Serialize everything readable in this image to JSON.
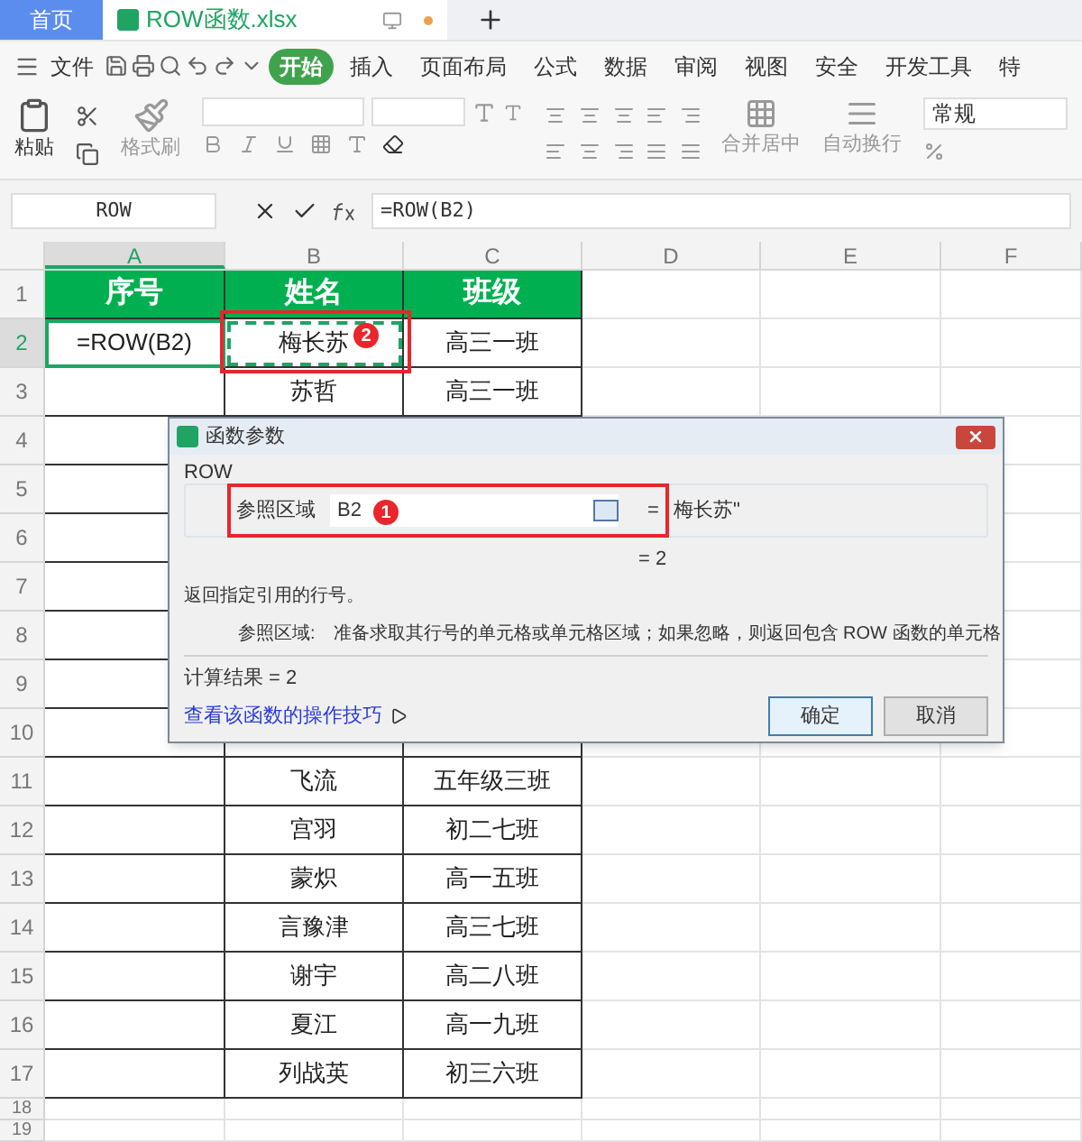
{
  "tabs": [
    {
      "label": "首页",
      "kind": "home",
      "selected": false
    },
    {
      "label": "ROW函数.xlsx",
      "kind": "file",
      "selected": true,
      "modified": true
    }
  ],
  "menu": {
    "file": "文件",
    "tabs": [
      {
        "label": "开始",
        "selected": true
      },
      {
        "label": "插入",
        "selected": false
      },
      {
        "label": "页面布局",
        "selected": false
      },
      {
        "label": "公式",
        "selected": false
      },
      {
        "label": "数据",
        "selected": false
      },
      {
        "label": "审阅",
        "selected": false
      },
      {
        "label": "视图",
        "selected": false
      },
      {
        "label": "安全",
        "selected": false
      },
      {
        "label": "开发工具",
        "selected": false
      },
      {
        "label": "特",
        "selected": false
      }
    ]
  },
  "ribbon": {
    "paste": "粘贴",
    "format_painter": "格式刷",
    "merge": "合并居中",
    "wrap": "自动换行",
    "number_format": "常规"
  },
  "formula_bar": {
    "name_box": "ROW",
    "formula": "=ROW(B2)"
  },
  "columns": [
    {
      "label": "A",
      "selected": true
    },
    {
      "label": "B",
      "selected": false
    },
    {
      "label": "C",
      "selected": false
    },
    {
      "label": "D",
      "selected": false
    },
    {
      "label": "E",
      "selected": false
    },
    {
      "label": "F",
      "selected": false
    }
  ],
  "rows": [
    {
      "header": "1",
      "kind": "heading",
      "selected": false,
      "referenced": false,
      "a": "序号",
      "b": "姓名",
      "c": "班级"
    },
    {
      "header": "2",
      "kind": "data",
      "selected": true,
      "referenced": true,
      "a": "=ROW(B2)",
      "b": "梅长苏",
      "c": "高三一班"
    },
    {
      "header": "3",
      "kind": "data",
      "selected": false,
      "referenced": false,
      "b": "苏哲",
      "c": "高三一班"
    },
    {
      "header": "4",
      "kind": "data",
      "selected": false
    },
    {
      "header": "5",
      "kind": "data",
      "selected": false
    },
    {
      "header": "6",
      "kind": "data",
      "selected": false
    },
    {
      "header": "7",
      "kind": "data",
      "selected": false
    },
    {
      "header": "8",
      "kind": "data",
      "selected": false
    },
    {
      "header": "9",
      "kind": "data",
      "selected": false
    },
    {
      "header": "10",
      "kind": "data",
      "selected": false
    },
    {
      "header": "11",
      "kind": "data",
      "selected": false,
      "referenced": false,
      "b": "飞流",
      "c": "五年级三班"
    },
    {
      "header": "12",
      "kind": "data",
      "selected": false,
      "referenced": false,
      "b": "宫羽",
      "c": "初二七班"
    },
    {
      "header": "13",
      "kind": "data",
      "selected": false,
      "referenced": false,
      "b": "蒙炽",
      "c": "高一五班"
    },
    {
      "header": "14",
      "kind": "data",
      "selected": false,
      "referenced": false,
      "b": "言豫津",
      "c": "高三七班"
    },
    {
      "header": "15",
      "kind": "data",
      "selected": false,
      "referenced": false,
      "b": "谢宇",
      "c": "高二八班"
    },
    {
      "header": "16",
      "kind": "data",
      "selected": false,
      "referenced": false,
      "b": "夏江",
      "c": "高一九班"
    },
    {
      "header": "17",
      "kind": "data",
      "selected": false,
      "referenced": false,
      "b": "列战英",
      "c": "初三六班"
    },
    {
      "header": "18",
      "kind": "blank",
      "selected": false,
      "referenced": false
    },
    {
      "header": "19",
      "kind": "blank",
      "selected": false,
      "referenced": false
    }
  ],
  "dialog": {
    "title": "函数参数",
    "function": "ROW",
    "param_label": "参照区域",
    "param_value": "B2",
    "equals": "=",
    "param_result": "梅长苏\"",
    "result_line": "= 2",
    "description": "返回指定引用的行号。",
    "param_help_label": "参照区域:",
    "param_help": "准备求取其行号的单元格或单元格区域；如果忽略，则返回包含 ROW 函数的单元格",
    "calc_result": "计算结果 = 2",
    "help_link": "查看该函数的操作技巧",
    "ok": "确定",
    "cancel": "取消"
  },
  "callouts": [
    {
      "number": "1"
    },
    {
      "number": "2"
    }
  ]
}
